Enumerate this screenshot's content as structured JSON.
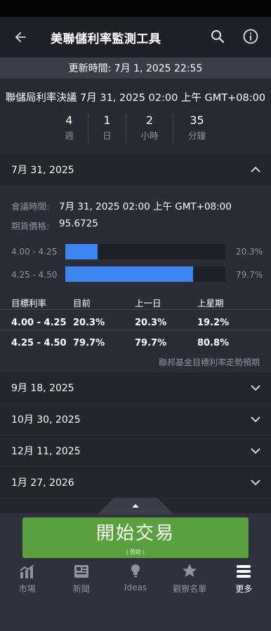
{
  "header": {
    "title": "美聯儲利率監測工具"
  },
  "update": {
    "text": "更新時間: 7月 1, 2025 22:55"
  },
  "decision": {
    "title": "聯儲局利率決議 7月 31, 2025 02:00 上午 GMT+08:00",
    "countdown": [
      {
        "value": "4",
        "unit": "週"
      },
      {
        "value": "1",
        "unit": "日"
      },
      {
        "value": "2",
        "unit": "小時"
      },
      {
        "value": "35",
        "unit": "分鐘"
      }
    ]
  },
  "meetings": [
    {
      "date": "7月 31, 2025",
      "expanded": true,
      "meeting_time_label": "會議時間:",
      "meeting_time": "7月 31, 2025 02:00 上午 GMT+08:00",
      "futures_label": "期貨價格:",
      "futures_price": "95.6725",
      "probabilities": [
        {
          "range": "4.00 - 4.25",
          "percent_label": "20.3%",
          "percent": 20.3
        },
        {
          "range": "4.25 - 4.50",
          "percent_label": "79.7%",
          "percent": 79.7
        }
      ],
      "table": {
        "headers": [
          "目標利率",
          "目前",
          "上一日",
          "上星期"
        ],
        "rows": [
          [
            "4.00 - 4.25",
            "20.3%",
            "20.3%",
            "19.2%"
          ],
          [
            "4.25 - 4.50",
            "79.7%",
            "79.7%",
            "80.8%"
          ]
        ]
      },
      "footnote": "聯邦基金目標利率走勢預期"
    },
    {
      "date": "9月 18, 2025"
    },
    {
      "date": "10月 30, 2025"
    },
    {
      "date": "12月 11, 2025"
    },
    {
      "date": "1月 27, 2026"
    }
  ],
  "cta": {
    "label": "開始交易",
    "sponsor": "| 贊助 |"
  },
  "nav": [
    {
      "label": "市場",
      "icon": "chart-icon"
    },
    {
      "label": "新聞",
      "icon": "news-icon"
    },
    {
      "label": "Ideas",
      "icon": "lightbulb-icon"
    },
    {
      "label": "觀察名單",
      "icon": "star-icon"
    },
    {
      "label": "更多",
      "icon": "menu-icon",
      "active": true
    }
  ],
  "colors": {
    "accent_blue": "#3d86f0",
    "cta_green": "#5aa03e"
  }
}
